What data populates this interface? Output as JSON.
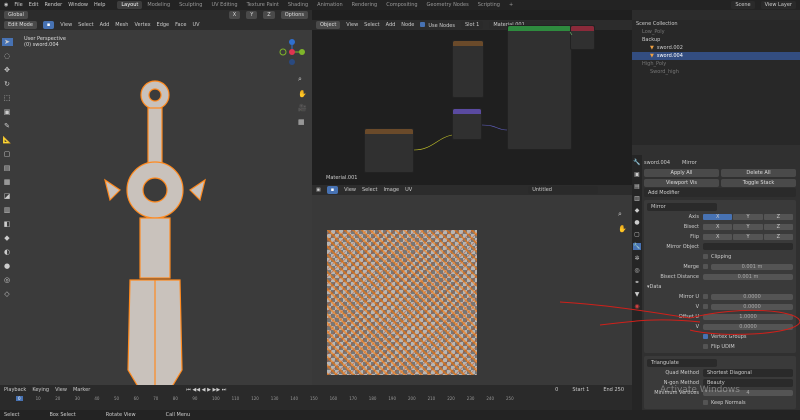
{
  "menu": [
    "File",
    "Edit",
    "Render",
    "Window",
    "Help"
  ],
  "workspaces": [
    {
      "label": "Layout",
      "active": true
    },
    {
      "label": "Modeling"
    },
    {
      "label": "Sculpting"
    },
    {
      "label": "UV Editing"
    },
    {
      "label": "Texture Paint"
    },
    {
      "label": "Shading"
    },
    {
      "label": "Animation"
    },
    {
      "label": "Rendering"
    },
    {
      "label": "Compositing"
    },
    {
      "label": "Geometry Nodes"
    },
    {
      "label": "Scripting"
    },
    {
      "label": "+"
    }
  ],
  "scene": {
    "scene_label": "Scene",
    "view_layer_label": "View Layer"
  },
  "viewport": {
    "orientation": "Global",
    "options": "Options",
    "mode": "Edit Mode",
    "menus": [
      "View",
      "Select",
      "Add",
      "Mesh",
      "Vertex",
      "Edge",
      "Face",
      "UV"
    ],
    "overlay_title": "User Perspective",
    "overlay_object": "(0) sword.004",
    "axes": [
      "X",
      "Y",
      "Z"
    ]
  },
  "node_editor": {
    "object_menu": "Object",
    "menus": [
      "View",
      "Select",
      "Add",
      "Node"
    ],
    "use_nodes": "Use Nodes",
    "slot": "Slot 1",
    "material": "Material.001",
    "footer_label": "Material.001"
  },
  "image_editor": {
    "menus": [
      "View",
      "Select",
      "Image",
      "UV"
    ],
    "image_name": "Untitled"
  },
  "outliner": {
    "items": [
      {
        "label": "Scene Collection",
        "depth": 0
      },
      {
        "label": "Low_Poly",
        "depth": 1,
        "dim": true
      },
      {
        "label": "Backup",
        "depth": 1
      },
      {
        "label": "sword.002",
        "depth": 2
      },
      {
        "label": "sword.004",
        "depth": 2,
        "selected": true
      },
      {
        "label": "High_Poly",
        "depth": 1,
        "dim": true
      },
      {
        "label": "Sword_high",
        "depth": 2,
        "dim": true
      }
    ]
  },
  "properties": {
    "object": "sword.004",
    "modifier_crumb": "Mirror",
    "apply_all": "Apply All",
    "delete_all": "Delete All",
    "viewport_vis": "Viewport Vis",
    "toggle_stack": "Toggle Stack",
    "add_modifier": "Add Modifier",
    "mirror": {
      "name": "Mirror",
      "axis_label": "Axis",
      "bisect_label": "Bisect",
      "flip_label": "Flip",
      "xyz": [
        "X",
        "Y",
        "Z"
      ],
      "mirror_object": "Mirror Object",
      "clipping": "Clipping",
      "merge": "Merge",
      "merge_value": "0.001 m",
      "bisect_distance": "Bisect Distance",
      "bisect_value": "0.001 m",
      "data": "Data",
      "mirror_u": "Mirror U",
      "mirror_u_value": "0.0000",
      "v_label": "V",
      "mirror_v_value": "0.0000",
      "offset_u": "Offset U",
      "offset_u_value": "1.0000",
      "offset_v_value": "0.0000",
      "vertex_groups": "Vertex Groups",
      "flip_udim": "Flip UDIM"
    },
    "triangulate": {
      "name": "Triangulate",
      "quad_method": "Quad Method",
      "quad_value": "Shortest Diagonal",
      "ngon_method": "N-gon Method",
      "ngon_value": "Beauty",
      "min_vertices": "Minimum Vertices",
      "min_value": "4",
      "keep_normals": "Keep Normals"
    }
  },
  "watermark": "Activate Windows",
  "timeline": {
    "menus": [
      "Playback",
      "Keying",
      "View",
      "Marker"
    ],
    "current": "0",
    "start_label": "Start",
    "start": "1",
    "end_label": "End",
    "end": "250",
    "ticks": [
      "0",
      "10",
      "20",
      "30",
      "40",
      "50",
      "60",
      "70",
      "80",
      "90",
      "100",
      "110",
      "120",
      "130",
      "140",
      "150",
      "160",
      "170",
      "180",
      "190",
      "200",
      "210",
      "220",
      "230",
      "240",
      "250"
    ]
  },
  "status": {
    "items": [
      "Select",
      "Box Select",
      "Rotate View",
      "Call Menu"
    ]
  },
  "colors": {
    "accent": "#4772b3",
    "selection": "#ff8a1f",
    "annotation": "#d0201a"
  }
}
